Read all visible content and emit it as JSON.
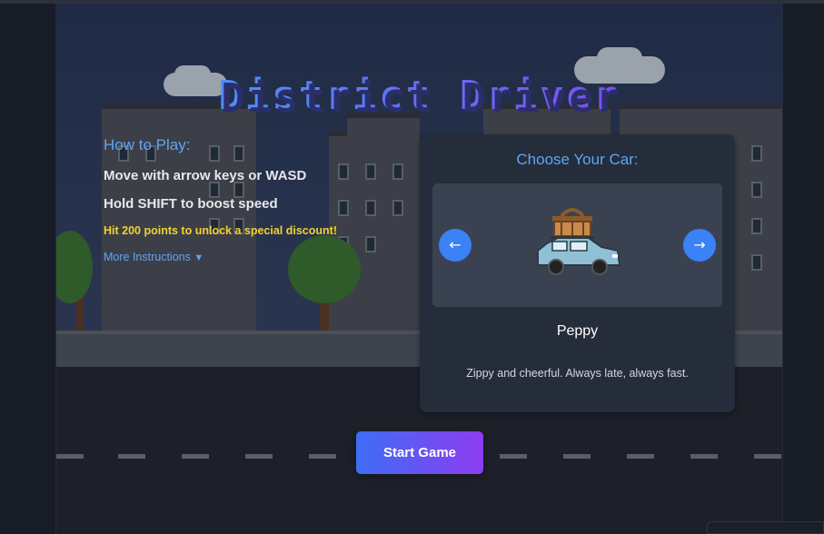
{
  "game": {
    "title": "District Driver"
  },
  "how_to_play": {
    "heading": "How to Play:",
    "lines": [
      "Move with arrow keys or WASD",
      "Hold SHIFT to boost speed"
    ],
    "tip": "Hit 200 points to unlock a special discount!",
    "more_label": "More Instructions",
    "more_arrow": "▼"
  },
  "car_select": {
    "heading": "Choose Your Car:",
    "prev_label": "←",
    "next_label": "→",
    "car_name": "Peppy",
    "car_description": "Zippy and cheerful. Always late, always fast."
  },
  "start_button": {
    "label": "Start Game"
  },
  "colors": {
    "accent_blue": "#3b82f6",
    "heading_blue": "#5ea5f5",
    "tip_yellow": "#f2d230",
    "gradient_start": "#3f6df6",
    "gradient_end": "#8c3cf0"
  }
}
